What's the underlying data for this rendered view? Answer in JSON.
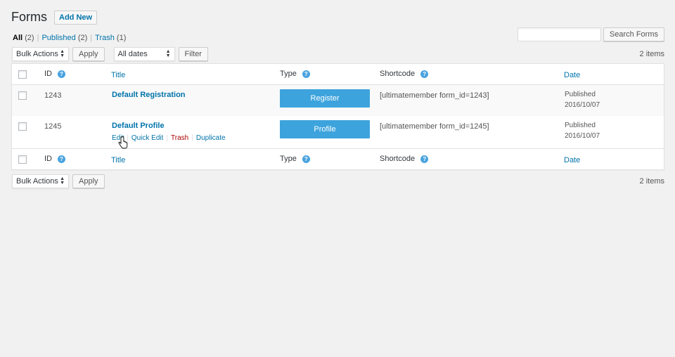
{
  "header": {
    "title": "Forms",
    "add_new_label": "Add New"
  },
  "views": {
    "all": {
      "label": "All",
      "count": "(2)"
    },
    "published": {
      "label": "Published",
      "count": "(2)"
    },
    "trash": {
      "label": "Trash",
      "count": "(1)"
    },
    "separator": "|"
  },
  "search": {
    "button_label": "Search Forms",
    "value": ""
  },
  "tablenav_top": {
    "bulk_actions": "Bulk Actions",
    "apply_label": "Apply",
    "dates": "All dates",
    "filter_label": "Filter",
    "items_count": "2 items"
  },
  "tablenav_bottom": {
    "bulk_actions": "Bulk Actions",
    "apply_label": "Apply",
    "items_count": "2 items"
  },
  "columns": {
    "id": "ID",
    "title": "Title",
    "type": "Type",
    "shortcode": "Shortcode",
    "date": "Date",
    "help_glyph": "?"
  },
  "rows": [
    {
      "id": "1243",
      "title": "Default Registration",
      "type": "Register",
      "shortcode": "[ultimatemember form_id=1243]",
      "status": "Published",
      "date": "2016/10/07"
    },
    {
      "id": "1245",
      "title": "Default Profile",
      "type": "Profile",
      "shortcode": "[ultimatemember form_id=1245]",
      "status": "Published",
      "date": "2016/10/07",
      "actions": {
        "edit": "Edit",
        "quick_edit": "Quick Edit",
        "trash": "Trash",
        "duplicate": "Duplicate",
        "sep": "|"
      }
    }
  ],
  "colors": {
    "link": "#0073aa",
    "type_button": "#3da3dd",
    "trash_link": "#a00"
  },
  "icons": {
    "help": "help-circle-icon",
    "cursor": "hand-pointer-icon"
  }
}
